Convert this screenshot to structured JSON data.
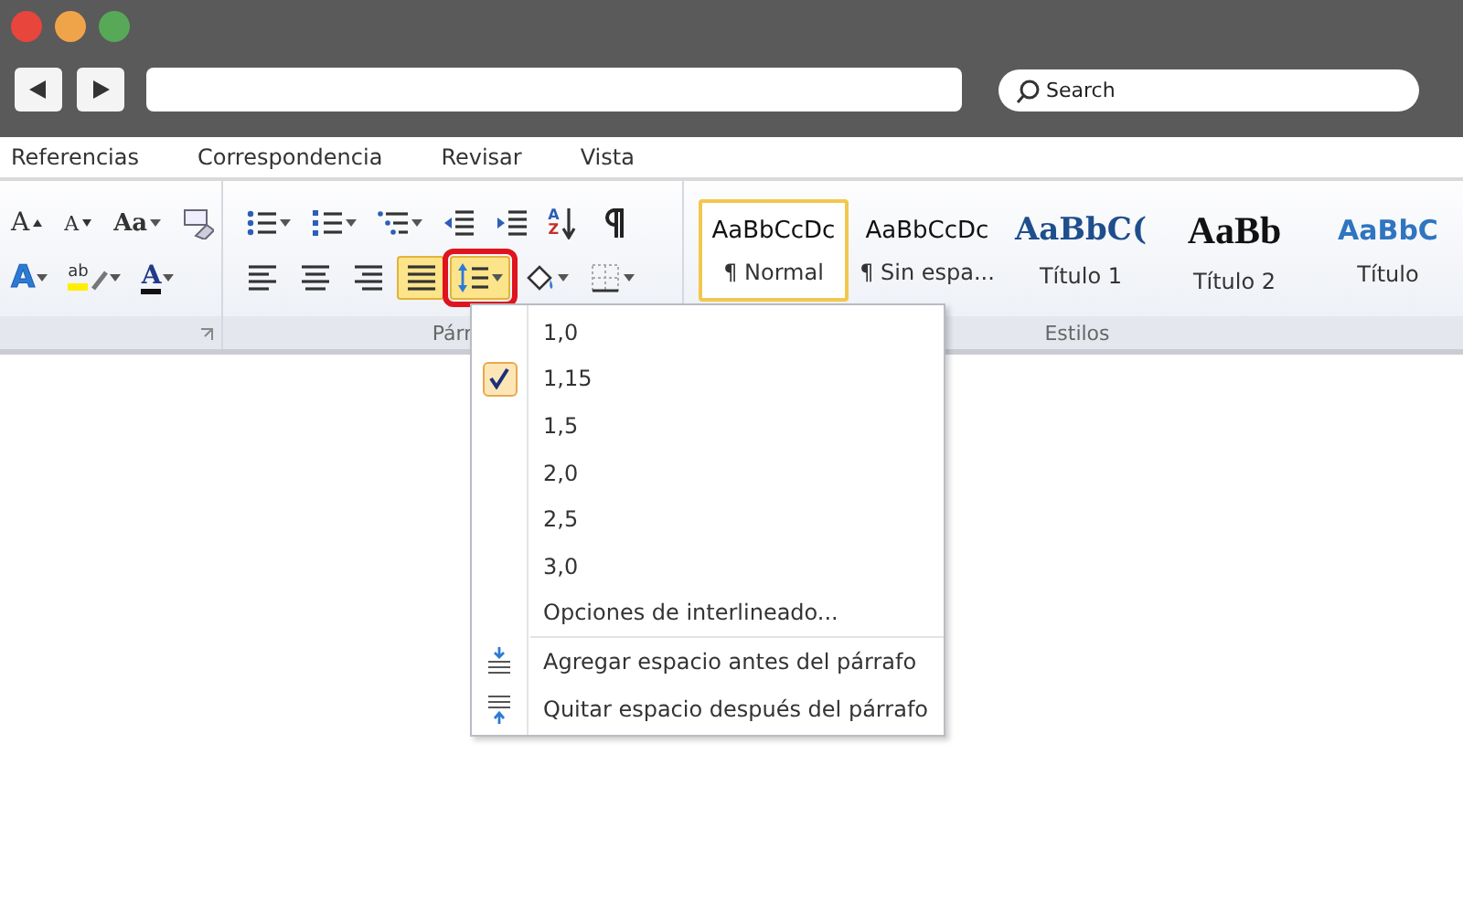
{
  "browser": {
    "search": {
      "placeholder": "Search"
    }
  },
  "menu": [
    {
      "label": "Referencias",
      "selected": false
    },
    {
      "label": "Correspondencia",
      "selected": false
    },
    {
      "label": "Revisar",
      "selected": false
    },
    {
      "label": "Vista",
      "selected": false
    }
  ],
  "ribbon": {
    "groups": [
      {
        "kind": "font",
        "rows": [
          [
            {
              "kind": "grow-font",
              "glyphs": [
                "A"
              ],
              "dropdown": false,
              "selected": false,
              "highlighted": false
            },
            {
              "kind": "shrink-font",
              "glyphs": [
                "A"
              ],
              "dropdown": false,
              "selected": false,
              "highlighted": false
            },
            {
              "kind": "change-case",
              "glyphs": [
                "Aa"
              ],
              "dropdown": true,
              "selected": false,
              "highlighted": false
            },
            {
              "kind": "clear-format",
              "dropdown": false,
              "selected": false,
              "highlighted": false
            }
          ],
          [
            {
              "kind": "text-effects",
              "glyphs": [
                "A"
              ],
              "dropdown": true,
              "selected": false,
              "highlighted": false
            },
            {
              "kind": "highlight",
              "glyphs": [
                "ab"
              ],
              "dropdown": true,
              "selected": false,
              "highlighted": false
            },
            {
              "kind": "font-color",
              "glyphs": [
                "A"
              ],
              "dropdown": true,
              "selected": false,
              "highlighted": false
            }
          ]
        ]
      },
      {
        "kind": "paragraph",
        "label": "Párr",
        "rows": [
          [
            {
              "kind": "bullets",
              "dropdown": true,
              "selected": false,
              "highlighted": false
            },
            {
              "kind": "numbering",
              "dropdown": true,
              "selected": false,
              "highlighted": false
            },
            {
              "kind": "multilevel",
              "dropdown": true,
              "selected": false,
              "highlighted": false
            },
            {
              "kind": "outdent",
              "dropdown": false,
              "selected": false,
              "highlighted": false
            },
            {
              "kind": "indent",
              "dropdown": false,
              "selected": false,
              "highlighted": false
            },
            {
              "kind": "sort",
              "glyphs": [
                "A",
                "Z"
              ],
              "dropdown": false,
              "selected": false,
              "highlighted": false
            },
            {
              "kind": "pilcrow",
              "dropdown": false,
              "selected": false,
              "highlighted": false
            }
          ],
          [
            {
              "kind": "align-left",
              "dropdown": false,
              "selected": false,
              "highlighted": false
            },
            {
              "kind": "center",
              "dropdown": false,
              "selected": false,
              "highlighted": false
            },
            {
              "kind": "align-right",
              "dropdown": false,
              "selected": false,
              "highlighted": false
            },
            {
              "kind": "justify",
              "dropdown": false,
              "selected": true,
              "highlighted": false
            },
            {
              "kind": "line-spacing",
              "dropdown": true,
              "selected": true,
              "highlighted": true
            },
            {
              "kind": "shading",
              "dropdown": true,
              "selected": false,
              "highlighted": false
            },
            {
              "kind": "borders",
              "dropdown": true,
              "selected": false,
              "highlighted": false
            }
          ]
        ]
      },
      {
        "kind": "styles",
        "label": "Estilos",
        "styles": [
          {
            "kind": "normal",
            "preview": "AaBbCcDc",
            "name": "¶ Normal",
            "selected": true
          },
          {
            "kind": "no-spacing",
            "preview": "AaBbCcDc",
            "name": "¶ Sin espa...",
            "selected": false
          },
          {
            "kind": "heading1",
            "preview": "AaBbC(",
            "name": "Título 1",
            "selected": false
          },
          {
            "kind": "heading2",
            "preview": "AaBb",
            "name": "Título 2",
            "selected": false
          },
          {
            "kind": "title",
            "preview": "AaBbC",
            "name": "Título",
            "selected": false
          }
        ]
      }
    ]
  },
  "dropdown": {
    "items": [
      {
        "kind": "spacing",
        "label": "1,0",
        "checked": false
      },
      {
        "kind": "spacing",
        "label": "1,15",
        "checked": true
      },
      {
        "kind": "spacing",
        "label": "1,5",
        "checked": false
      },
      {
        "kind": "spacing",
        "label": "2,0",
        "checked": false
      },
      {
        "kind": "spacing",
        "label": "2,5",
        "checked": false
      },
      {
        "kind": "spacing",
        "label": "3,0",
        "checked": false
      },
      {
        "kind": "option",
        "label": "Opciones de interlineado..."
      },
      {
        "kind": "add-before",
        "label": "Agregar espacio antes del párrafo"
      },
      {
        "kind": "remove-after",
        "label": "Quitar espacio después del párrafo"
      }
    ]
  }
}
